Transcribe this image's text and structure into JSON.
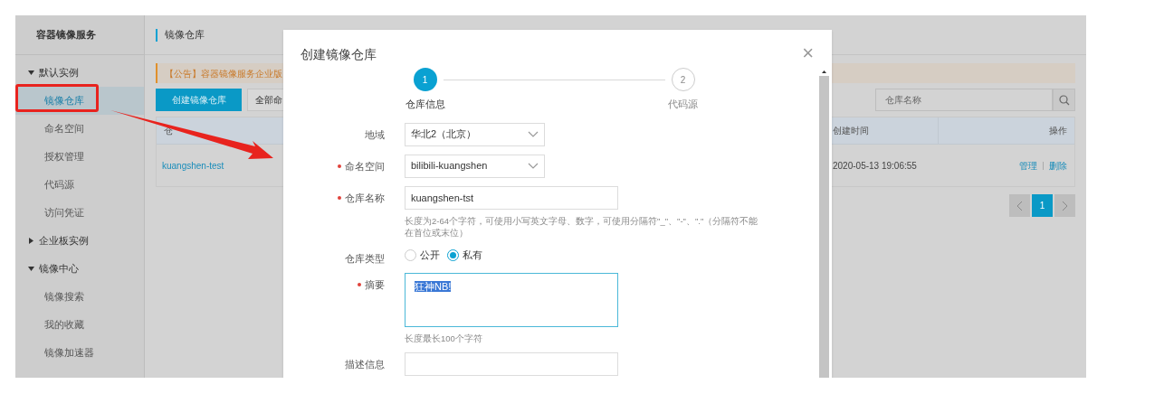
{
  "sidebar": {
    "title": "容器镜像服务",
    "groups": [
      {
        "label": "默认实例",
        "expanded": true,
        "items": [
          {
            "label": "镜像仓库",
            "selected": true
          },
          {
            "label": "命名空间",
            "selected": false
          },
          {
            "label": "授权管理",
            "selected": false
          },
          {
            "label": "代码源",
            "selected": false
          },
          {
            "label": "访问凭证",
            "selected": false
          }
        ]
      },
      {
        "label": "企业板实例",
        "expanded": false
      },
      {
        "label": "镜像中心",
        "expanded": true,
        "items": [
          {
            "label": "镜像搜索",
            "selected": false
          },
          {
            "label": "我的收藏",
            "selected": false
          },
          {
            "label": "镜像加速器",
            "selected": false
          }
        ]
      }
    ]
  },
  "main": {
    "title": "镜像仓库",
    "notice": "【公告】容器镜像服务企业版",
    "create_button": "创建镜像仓库",
    "filter": "全部命",
    "search": {
      "placeholder": "仓库名称"
    },
    "table": {
      "columns": [
        "仓",
        "创建时间",
        "操作"
      ],
      "rows": [
        {
          "name": "kuangshen-test",
          "created": "2020-05-13 19:06:55",
          "actions": [
            "管理",
            "删除"
          ]
        }
      ]
    },
    "pagination": {
      "pages": [
        {
          "label": "1",
          "selected": true
        }
      ]
    }
  },
  "dialog": {
    "title": "创建镜像仓库",
    "close": "×",
    "steps": [
      {
        "number": "1",
        "label": "仓库信息",
        "selected": true
      },
      {
        "number": "2",
        "label": "代码源",
        "selected": false
      }
    ],
    "fields": [
      {
        "kind": "select",
        "label": "地域",
        "required": false,
        "value": "华北2（北京）"
      },
      {
        "kind": "select",
        "label": "命名空间",
        "required": true,
        "value": "bilibili-kuangshen"
      },
      {
        "kind": "input",
        "label": "仓库名称",
        "required": true,
        "value": "kuangshen-tst",
        "hint": "长度为2-64个字符，可使用小写英文字母、数字，可使用分隔符\"_\"、\"-\"、\".\"（分隔符不能在首位或末位）"
      },
      {
        "kind": "radio",
        "label": "仓库类型",
        "required": false,
        "options": [
          {
            "label": "公开",
            "selected": false
          },
          {
            "label": "私有",
            "selected": true
          }
        ]
      },
      {
        "kind": "textarea",
        "label": "摘要",
        "required": true,
        "value": "狂神NB!",
        "hint": "长度最长100个字符"
      },
      {
        "kind": "input",
        "label": "描述信息",
        "required": false
      }
    ]
  }
}
